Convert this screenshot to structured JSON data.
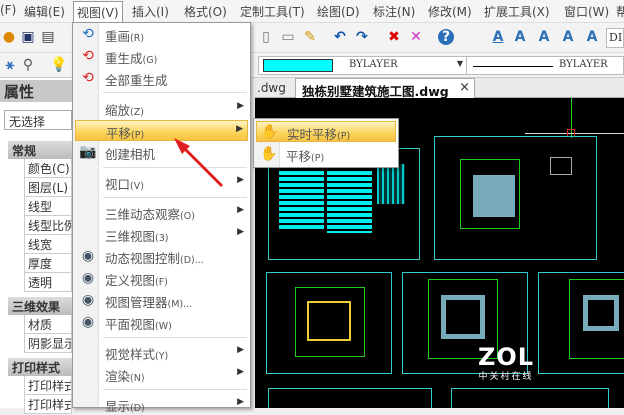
{
  "menubar": {
    "items": [
      "(F)",
      "编辑(E)",
      "视图(V)",
      "插入(I)",
      "格式(O)",
      "定制工具(T)",
      "绘图(D)",
      "标注(N)",
      "修改(M)",
      "扩展工具(X)",
      "窗口(W)",
      "帮"
    ]
  },
  "toolbar": {
    "color_value": "BYLAYER",
    "linetype_value": "BYLAYER",
    "style_value": "DI",
    "color_swatch": "#00ffff"
  },
  "properties": {
    "title": "属性",
    "selection": "无选择",
    "sections": [
      {
        "title": "常规",
        "props": [
          "颜色(C)",
          "图层(L)",
          "线型",
          "线型比例",
          "线宽",
          "厚度",
          "透明"
        ]
      },
      {
        "title": "三维效果",
        "props": [
          "材质",
          "阴影显示"
        ]
      },
      {
        "title": "打印样式",
        "props": [
          "打印样式",
          "打印样式"
        ]
      }
    ]
  },
  "tabs": [
    {
      "label": ".dwg"
    },
    {
      "label": "独栋别墅建筑施工图.dwg",
      "close": "×"
    }
  ],
  "view_menu": {
    "items": [
      {
        "label": "重画",
        "key": "(R)",
        "icon": "redraw-icon"
      },
      {
        "label": "重生成",
        "key": "(G)",
        "icon": "regen-icon"
      },
      {
        "label": "全部重生成",
        "key": "",
        "icon": "regen-all-icon"
      },
      {
        "label": "缩放",
        "key": "(Z)",
        "submenu": true
      },
      {
        "label": "平移",
        "key": "(P)",
        "submenu": true,
        "highlighted": true
      },
      {
        "label": "创建相机",
        "key": "",
        "icon": "camera-icon"
      },
      {
        "label": "视口",
        "key": "(V)",
        "submenu": true
      },
      {
        "label": "三维动态观察",
        "key": "(O)",
        "submenu": true
      },
      {
        "label": "三维视图",
        "key": "(3)",
        "submenu": true
      },
      {
        "label": "动态视图控制",
        "key": "(D)...",
        "icon": "eye-icon"
      },
      {
        "label": "定义视图",
        "key": "(F)",
        "icon": "eye-icon"
      },
      {
        "label": "视图管理器",
        "key": "(M)...",
        "icon": "eye-icon"
      },
      {
        "label": "平面视图",
        "key": "(W)",
        "icon": "eye-icon"
      },
      {
        "label": "视觉样式",
        "key": "(Y)",
        "submenu": true
      },
      {
        "label": "渲染",
        "key": "(N)",
        "submenu": true
      },
      {
        "label": "显示",
        "key": "(D)",
        "submenu": true
      }
    ]
  },
  "pan_submenu": {
    "items": [
      {
        "label": "实时平移",
        "key": "(P)",
        "highlighted": true
      },
      {
        "label": "平移",
        "key": "(P)"
      }
    ]
  },
  "watermark": {
    "logo": "ZOL",
    "text": "中关村在线"
  }
}
